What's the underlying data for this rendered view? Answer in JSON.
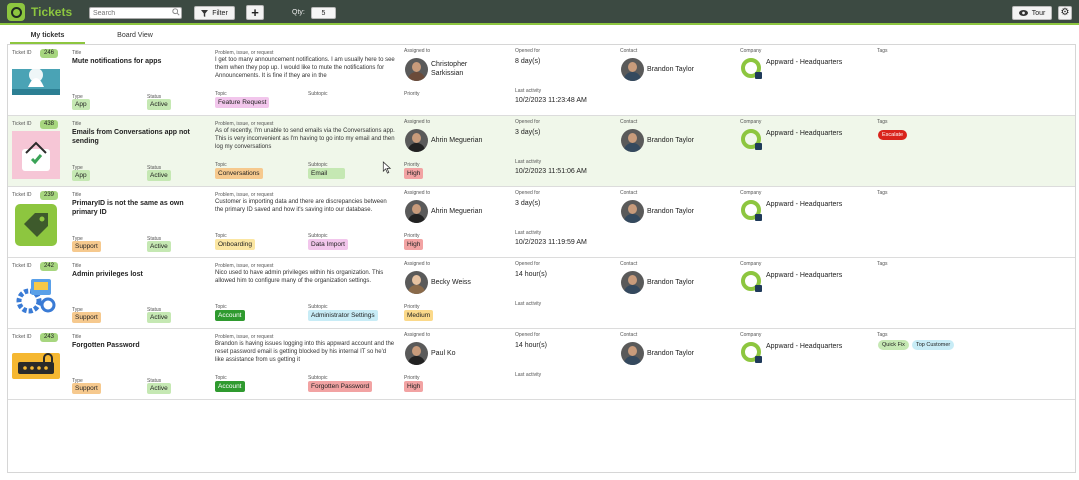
{
  "app": {
    "title": "Tickets"
  },
  "toolbar": {
    "search_placeholder": "Search",
    "filter_label": "Filter",
    "add_label": "+",
    "qty_label": "Qty:",
    "qty_value": "5",
    "tour_label": "Tour"
  },
  "tabs": [
    {
      "label": "My tickets",
      "active": true
    },
    {
      "label": "Board View",
      "active": false
    }
  ],
  "labels": {
    "ticket_id": "Ticket ID",
    "title": "Title",
    "type": "Type",
    "status": "Status",
    "problem": "Problem, issue, or request",
    "topic": "Topic",
    "subtopic": "Subtopic",
    "assigned_to": "Assigned to",
    "priority": "Priority",
    "opened_for": "Opened for",
    "last_activity": "Last activity",
    "contact": "Contact",
    "company": "Company",
    "tags": "Tags"
  },
  "colors": {
    "brand_green": "#8dc63f",
    "topbar": "#3c4a42",
    "highlight_row": "#f0f7ea"
  },
  "tickets": [
    {
      "id": "246",
      "title": "Mute notifications for apps",
      "type": "App",
      "status": "Active",
      "description": "I get too many announcement notifications. I am usually here to see them when they pop up. I would like to mute the notifications for Announcements. It is fine if they are in the",
      "topic": "Feature Request",
      "subtopic": "",
      "assigned_to": "Christopher Sarkissian",
      "priority": "",
      "opened_for": "8 day(s)",
      "last_activity": "10/2/2023 11:23:48 AM",
      "contact": "Brandon Taylor",
      "company": "Appward - Headquarters",
      "tags": [],
      "thumb_icon": "bell-mute-icon"
    },
    {
      "id": "438",
      "title": "Emails from Conversations app not sending",
      "type": "App",
      "status": "Active",
      "description": "As of recently, I'm unable to send emails via the Conversations app. This is very inconvenient as I'm having to go into my email and then log my conversations",
      "topic": "Conversations",
      "subtopic": "Email",
      "assigned_to": "Ahrin Meguerian",
      "priority": "High",
      "opened_for": "3 day(s)",
      "last_activity": "10/2/2023 11:51:06 AM",
      "contact": "Brandon Taylor",
      "company": "Appward - Headquarters",
      "tags": [
        "Escalate"
      ],
      "thumb_icon": "mailbox-icon"
    },
    {
      "id": "239",
      "title": "PrimaryID is not the same as own primary ID",
      "type": "Support",
      "status": "Active",
      "description": "Customer is importing data and there are discrepancies between the primary ID saved and how it's saving into our database.",
      "topic": "Onboarding",
      "subtopic": "Data Import",
      "assigned_to": "Ahrin Meguerian",
      "priority": "High",
      "opened_for": "3 day(s)",
      "last_activity": "10/2/2023 11:19:59 AM",
      "contact": "Brandon Taylor",
      "company": "Appward - Headquarters",
      "tags": [],
      "thumb_icon": "tag-icon"
    },
    {
      "id": "242",
      "title": "Admin privileges lost",
      "type": "Support",
      "status": "Active",
      "description": "Nico used to have admin privileges within his organization. This allowed him to configure many of the organization settings.",
      "topic": "Account",
      "subtopic": "Administrator Settings",
      "assigned_to": "Becky Weiss",
      "priority": "Medium",
      "opened_for": "14 hour(s)",
      "last_activity": "",
      "contact": "Brandon Taylor",
      "company": "Appward - Headquarters",
      "tags": [],
      "thumb_icon": "admin-gear-icon"
    },
    {
      "id": "243",
      "title": "Forgotten Password",
      "type": "Support",
      "status": "Active",
      "description": "Brandon is having issues logging into this appward account and the reset password email is getting blocked by his internal IT so he'd like assistance from us getting it",
      "topic": "Account",
      "subtopic": "Forgotten Password",
      "assigned_to": "Paul Ko",
      "priority": "High",
      "opened_for": "14 hour(s)",
      "last_activity": "",
      "contact": "Brandon Taylor",
      "company": "Appward - Headquarters",
      "tags": [
        "Quick Fix",
        "Top Customer"
      ],
      "thumb_icon": "password-lock-icon"
    }
  ]
}
